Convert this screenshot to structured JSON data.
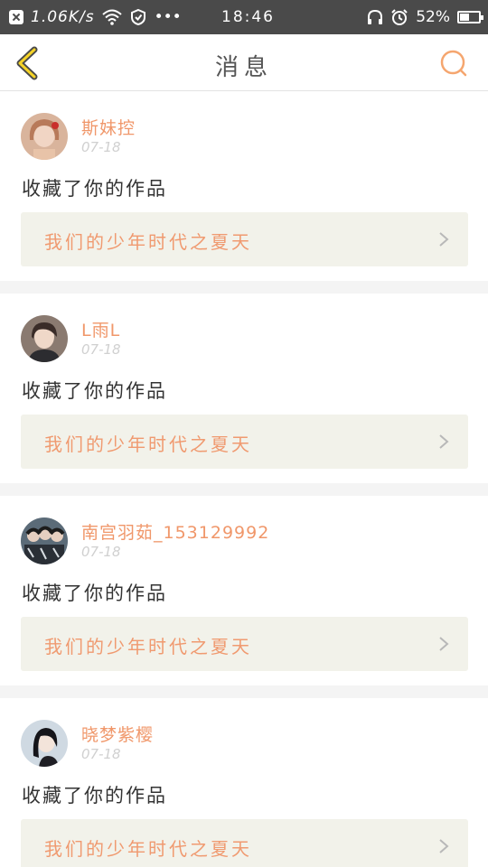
{
  "status_bar": {
    "speed": "1.06K/s",
    "dots": "•••",
    "time": "18:46",
    "battery": "52%",
    "battery_level": 0.52
  },
  "header": {
    "title": "消息",
    "accent_color": "#f5a66f"
  },
  "messages": [
    {
      "username": "斯妹控",
      "date": "07-18",
      "action": "收藏了你的作品",
      "work_title": "我们的少年时代之夏天",
      "avatar_color": "#c89a7c"
    },
    {
      "username": "L雨L",
      "date": "07-18",
      "action": "收藏了你的作品",
      "work_title": "我们的少年时代之夏天",
      "avatar_color": "#6b5e57"
    },
    {
      "username": "南宫羽茹_153129992",
      "date": "07-18",
      "action": "收藏了你的作品",
      "work_title": "我们的少年时代之夏天",
      "avatar_color": "#4a5866"
    },
    {
      "username": "晓梦紫樱",
      "date": "07-18",
      "action": "收藏了你的作品",
      "work_title": "我们的少年时代之夏天",
      "avatar_color": "#8fa3b5"
    }
  ]
}
